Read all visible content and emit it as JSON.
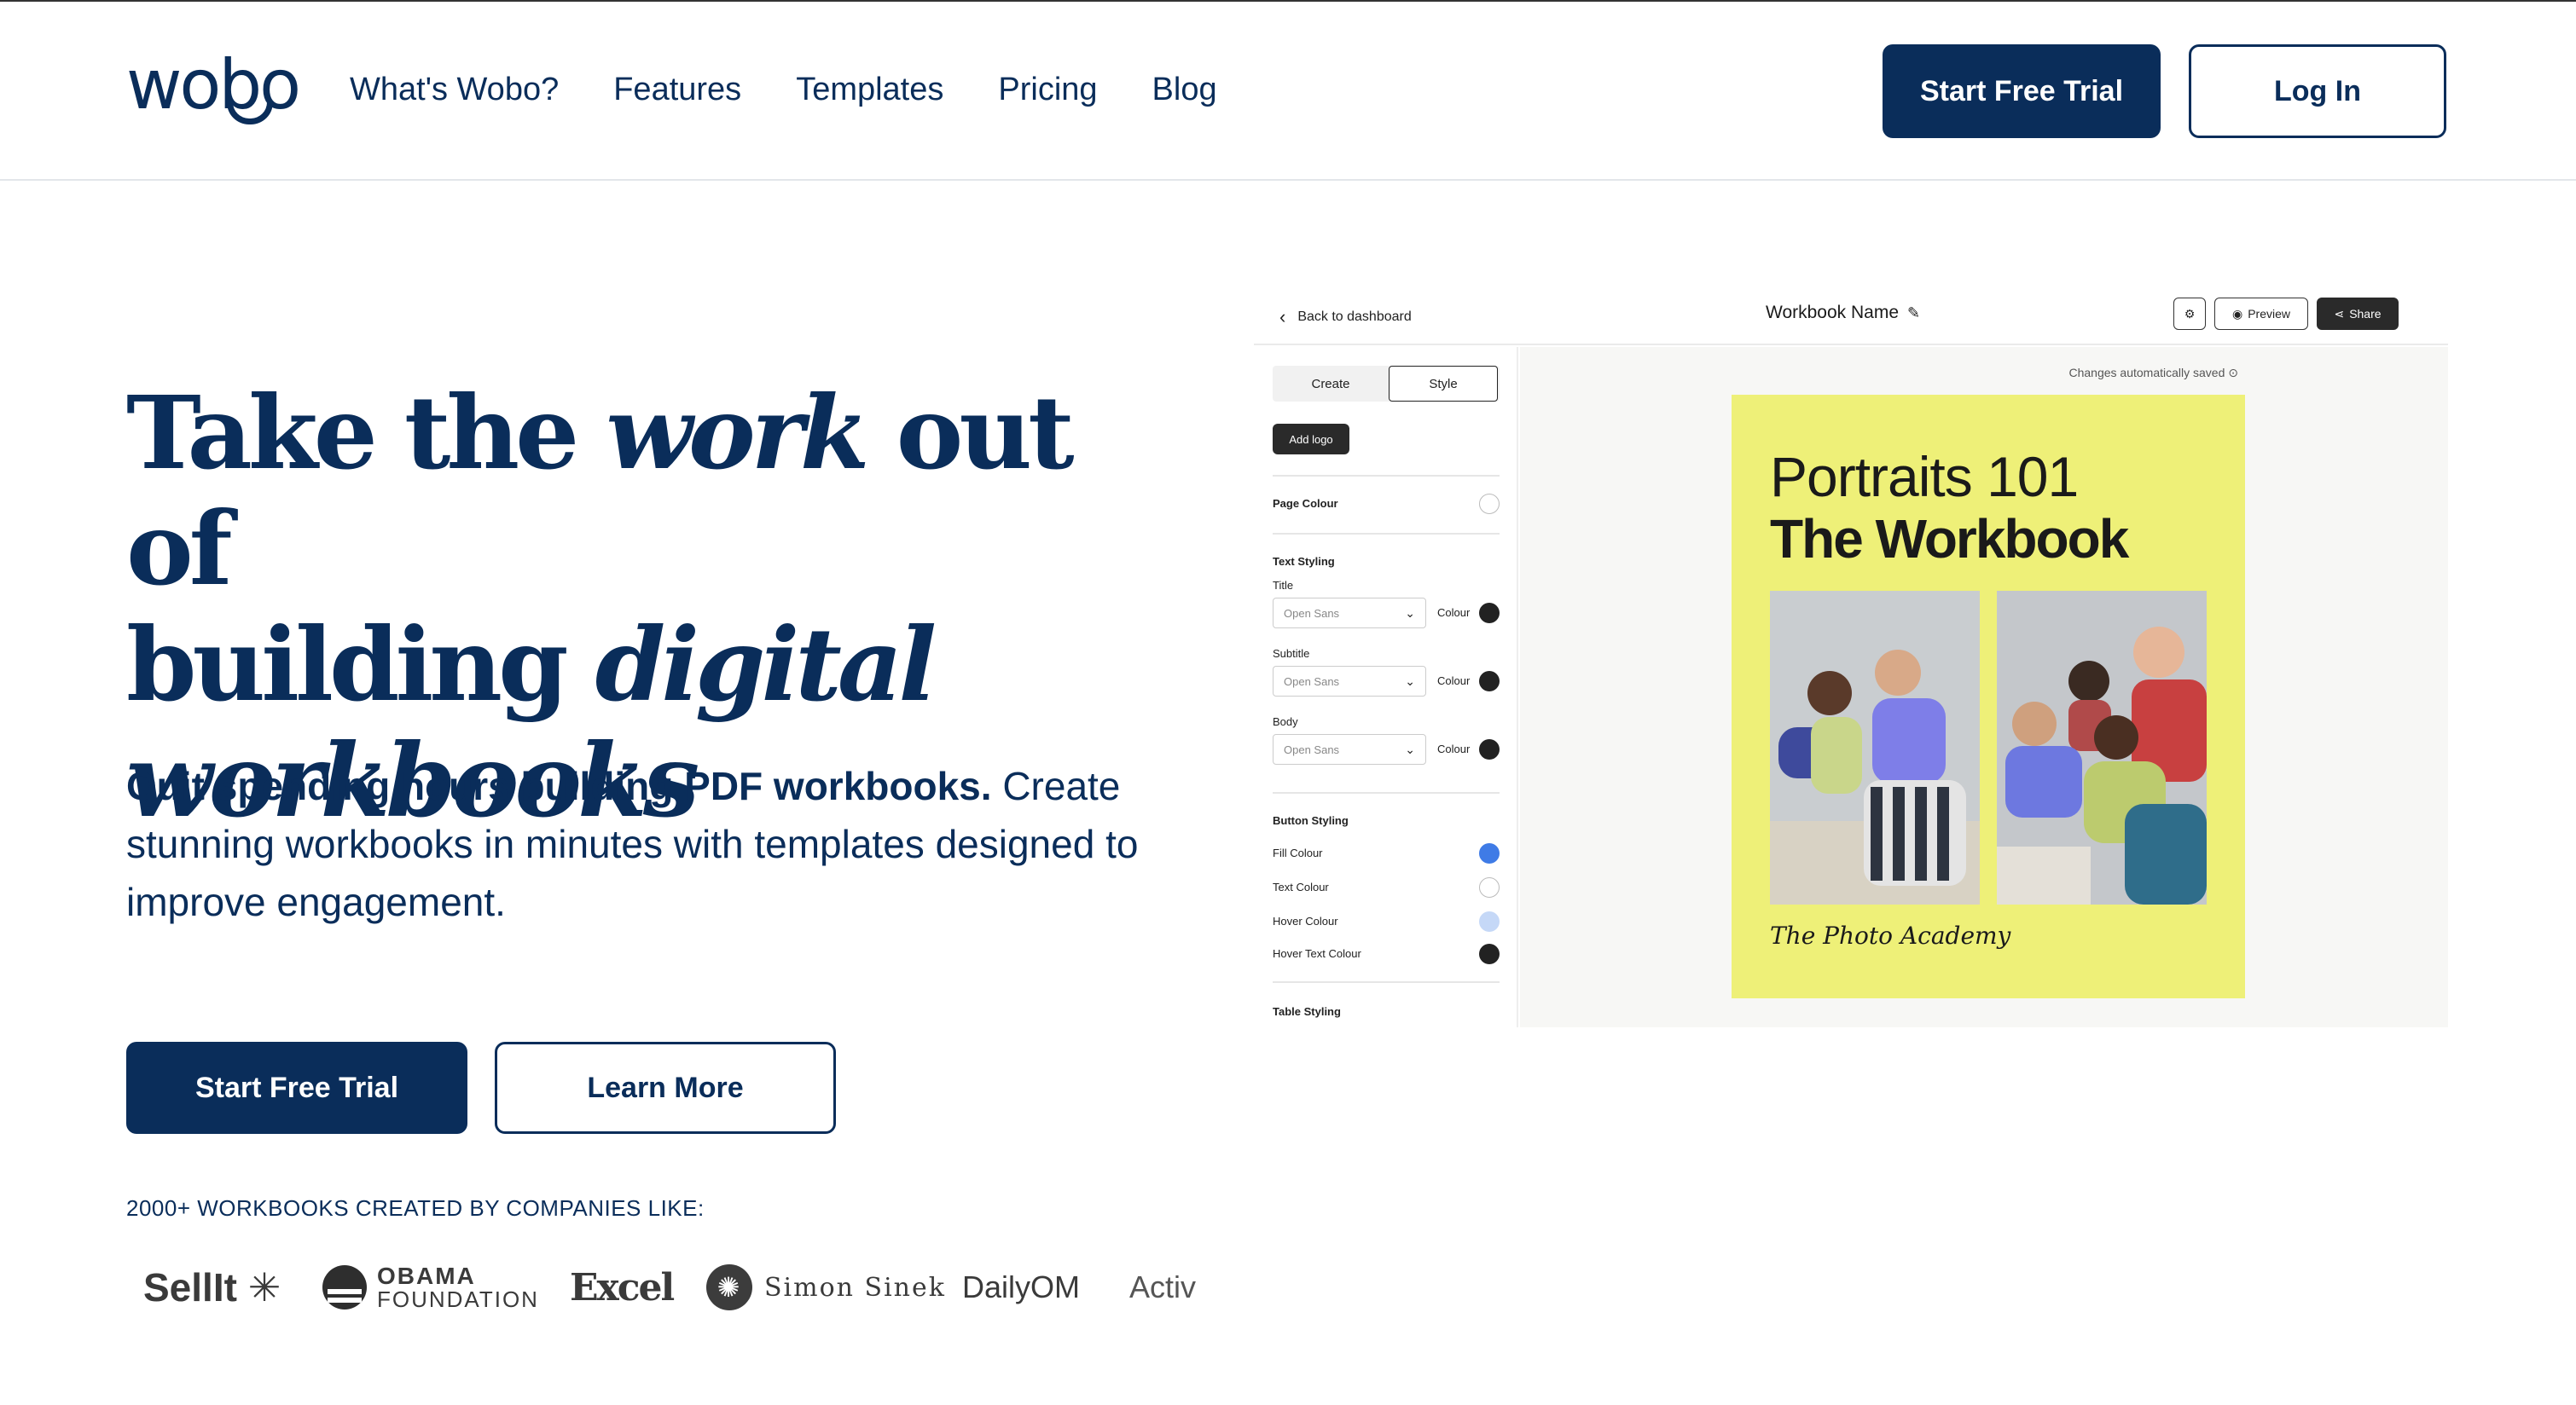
{
  "nav": {
    "logo": "wobo",
    "links": [
      "What's Wobo?",
      "Features",
      "Templates",
      "Pricing",
      "Blog"
    ],
    "start_trial": "Start Free Trial",
    "login": "Log In"
  },
  "hero": {
    "title_1": "Take the",
    "title_2": "work",
    "title_3": "out of",
    "title_4": "building",
    "title_5": "digital",
    "title_6": "workbooks",
    "sub_bold": "Quit spending hours building PDF workbooks.",
    "sub_rest": " Create stunning workbooks in minutes with templates designed to improve engagement.",
    "start_trial": "Start Free Trial",
    "learn_more": "Learn More",
    "companies_label": "2000+ WORKBOOKS CREATED BY COMPANIES LIKE:",
    "companies": {
      "sellit": "SellIt",
      "obama_1": "OBAMA",
      "obama_2": "FOUNDATION",
      "excel": "Excel",
      "sinek": "Simon Sinek",
      "dailyom": "DailyOM",
      "activ": "Activ"
    }
  },
  "mockup": {
    "back": "Back to dashboard",
    "workbook_name": "Workbook Name",
    "preview": "Preview",
    "share": "Share",
    "tabs": [
      "Create",
      "Style"
    ],
    "add_logo": "Add logo",
    "page_colour": "Page Colour",
    "text_styling": "Text Styling",
    "title_lbl": "Title",
    "subtitle_lbl": "Subtitle",
    "body_lbl": "Body",
    "font": "Open Sans",
    "colour": "Colour",
    "button_styling": "Button Styling",
    "fill_colour": "Fill Colour",
    "text_colour": "Text Colour",
    "hover_colour": "Hover Colour",
    "hover_text_colour": "Hover Text Colour",
    "table_styling": "Table Styling",
    "saved": "Changes automatically saved",
    "cover_title": "Portraits 101",
    "cover_subtitle": "The Workbook",
    "cover_by": "The Photo Academy"
  },
  "colors": {
    "brand": "#0a2d5a",
    "cover": "#eef078",
    "fill_swatch": "#3f7be6",
    "hover_swatch": "#c5d8f7"
  }
}
